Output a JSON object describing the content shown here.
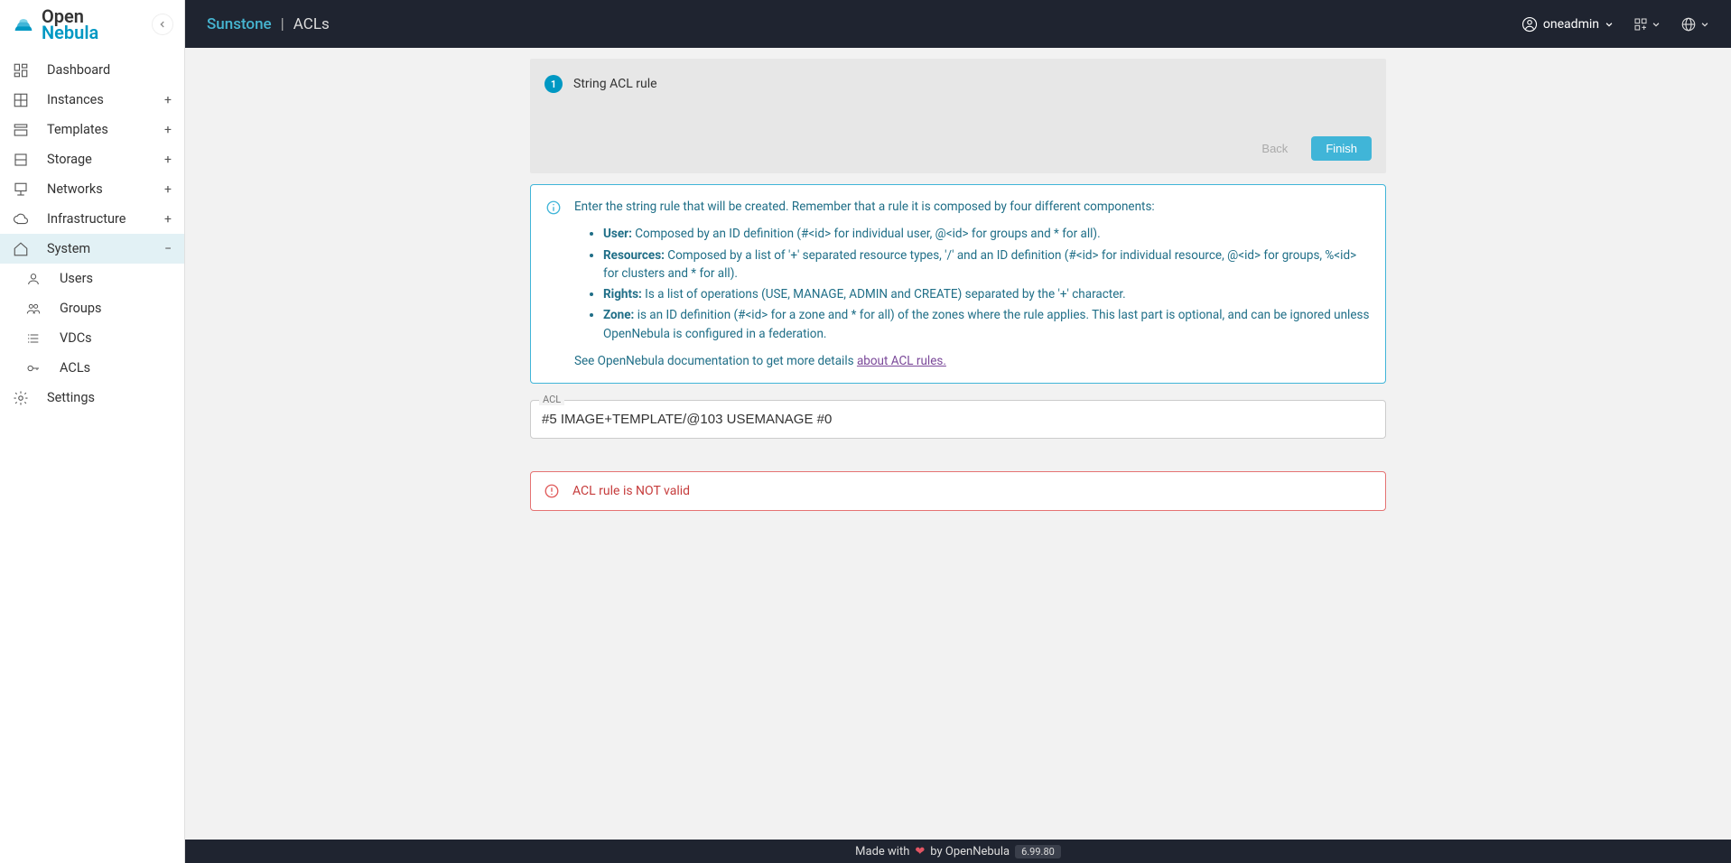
{
  "header": {
    "app_name": "Sunstone",
    "separator": "|",
    "page": "ACLs",
    "username": "oneadmin"
  },
  "sidebar": {
    "items": [
      {
        "label": "Dashboard"
      },
      {
        "label": "Instances"
      },
      {
        "label": "Templates"
      },
      {
        "label": "Storage"
      },
      {
        "label": "Networks"
      },
      {
        "label": "Infrastructure"
      },
      {
        "label": "System"
      },
      {
        "label": "Settings"
      }
    ],
    "system_children": [
      {
        "label": "Users"
      },
      {
        "label": "Groups"
      },
      {
        "label": "VDCs"
      },
      {
        "label": "ACLs"
      }
    ]
  },
  "wizard": {
    "step_num": "1",
    "step_label": "String ACL rule",
    "back": "Back",
    "finish": "Finish"
  },
  "info": {
    "intro": "Enter the string rule that will be created. Remember that a rule it is composed by four different components:",
    "user_label": "User:",
    "user_text": " Composed by an ID definition (#<id> for individual user, @<id> for groups and * for all).",
    "res_label": "Resources:",
    "res_text": " Composed by a list of '+' separated resource types, '/' and an ID definition (#<id> for individual resource, @<id> for groups, %<id> for clusters and * for all).",
    "rights_label": "Rights:",
    "rights_text": " Is a list of operations (USE, MANAGE, ADMIN and CREATE) separated by the '+' character.",
    "zone_label": "Zone:",
    "zone_text": " is an ID definition (#<id> for a zone and * for all) of the zones where the rule applies. This last part is optional, and can be ignored unless OpenNebula is configured in a federation.",
    "doc_prefix": "See OpenNebula documentation to get more details ",
    "doc_link": "about ACL rules."
  },
  "field": {
    "label": "ACL",
    "value": "#5 IMAGE+TEMPLATE/@103 USEMANAGE #0"
  },
  "error": {
    "message": "ACL rule is NOT valid"
  },
  "footer": {
    "made": "Made with",
    "by": "by OpenNebula",
    "version": "6.99.80"
  }
}
